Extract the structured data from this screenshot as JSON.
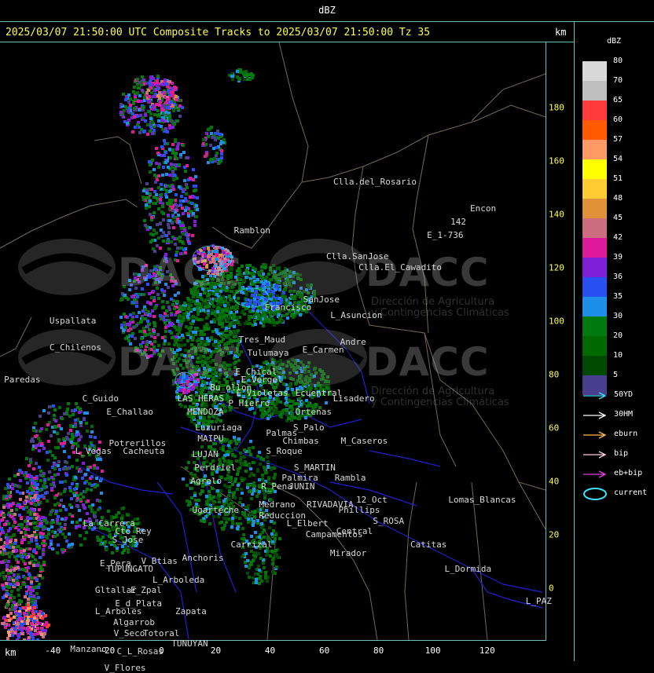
{
  "header": {
    "title": "dBZ"
  },
  "map": {
    "track_title": "2025/03/07 21:50:00 UTC Composite Tracks to 2025/03/07 21:50:00 Tz 35",
    "km_label": "km",
    "x_ticks": [
      -40,
      -20,
      0,
      20,
      40,
      60,
      80,
      100,
      120
    ],
    "y_ticks": [
      180,
      160,
      140,
      120,
      100,
      80,
      60,
      40,
      20,
      0
    ],
    "xlim": [
      -59.5,
      141.5
    ],
    "ylim": [
      -19.5,
      204.5
    ],
    "watermark": {
      "brand": "DACC",
      "line1": "Dirección de Agricultura",
      "line2": "y Contingencias Climáticas"
    },
    "places": [
      {
        "name": "Clla.del_Rosario",
        "x": 63.3,
        "y": 152
      },
      {
        "name": "Encon",
        "x": 113.7,
        "y": 142
      },
      {
        "name": "142",
        "x": 106.5,
        "y": 137
      },
      {
        "name": "E_1-736",
        "x": 97.8,
        "y": 132
      },
      {
        "name": "Ramblon",
        "x": 26.7,
        "y": 134
      },
      {
        "name": "Clla.SanJose",
        "x": 60.7,
        "y": 124
      },
      {
        "name": "Clla.El_Cawadito",
        "x": 72.6,
        "y": 120
      },
      {
        "name": "SanJose",
        "x": 52.2,
        "y": 108
      },
      {
        "name": "Francisco",
        "x": 38,
        "y": 105
      },
      {
        "name": "L_Asuncion",
        "x": 62.2,
        "y": 102
      },
      {
        "name": "Uspallata",
        "x": -41.3,
        "y": 100
      },
      {
        "name": "C_Chilenos",
        "x": -41.3,
        "y": 90
      },
      {
        "name": "Tres_Maud",
        "x": 28.4,
        "y": 93
      },
      {
        "name": "E_Carmen",
        "x": 51.9,
        "y": 89
      },
      {
        "name": "Andre",
        "x": 65.8,
        "y": 92
      },
      {
        "name": "Tulumaya",
        "x": 31.6,
        "y": 88
      },
      {
        "name": "Paredas",
        "x": -58,
        "y": 78
      },
      {
        "name": "E_Chical",
        "x": 27.2,
        "y": 81
      },
      {
        "name": "E_Vergel",
        "x": 29.3,
        "y": 78
      },
      {
        "name": "Ecuentral",
        "x": 49.3,
        "y": 73
      },
      {
        "name": "Bu_ollon",
        "x": 17.9,
        "y": 75
      },
      {
        "name": "E_Violetas",
        "x": 27.5,
        "y": 73
      },
      {
        "name": "Lisadero",
        "x": 63.2,
        "y": 71
      },
      {
        "name": "C_Guido",
        "x": -29.2,
        "y": 71
      },
      {
        "name": "LAS_HERAS",
        "x": 5.8,
        "y": 71
      },
      {
        "name": "P_Hierro",
        "x": 24.6,
        "y": 69
      },
      {
        "name": "E_Challao",
        "x": -20.3,
        "y": 66
      },
      {
        "name": "MENDOZA",
        "x": 9.5,
        "y": 66
      },
      {
        "name": "Ortenas",
        "x": 49.3,
        "y": 66
      },
      {
        "name": "Luzuriaga",
        "x": 12.4,
        "y": 60
      },
      {
        "name": "S_Palo",
        "x": 48.5,
        "y": 60
      },
      {
        "name": "Palmas",
        "x": 38.5,
        "y": 58
      },
      {
        "name": "Potrerillos",
        "x": -19.4,
        "y": 54
      },
      {
        "name": "MAIPU",
        "x": 13.3,
        "y": 56
      },
      {
        "name": "Chimbas",
        "x": 44.6,
        "y": 55
      },
      {
        "name": "M_Caseros",
        "x": 66.1,
        "y": 55
      },
      {
        "name": "L_Vegas",
        "x": -31.8,
        "y": 51
      },
      {
        "name": "Cacheuta",
        "x": -14.2,
        "y": 51
      },
      {
        "name": "LUJAN",
        "x": 11.3,
        "y": 50
      },
      {
        "name": "S_Roque",
        "x": 38.5,
        "y": 51
      },
      {
        "name": "Perdriel",
        "x": 12.1,
        "y": 45
      },
      {
        "name": "S_MARTIN",
        "x": 48.8,
        "y": 45
      },
      {
        "name": "Agrelo",
        "x": 10.7,
        "y": 40
      },
      {
        "name": "Palmira",
        "x": 44.3,
        "y": 41
      },
      {
        "name": "Rambla",
        "x": 63.8,
        "y": 41
      },
      {
        "name": "R_Pena",
        "x": 36.7,
        "y": 38
      },
      {
        "name": "JUNIN",
        "x": 46.9,
        "y": 38
      },
      {
        "name": "Lomas_Blancas",
        "x": 105.7,
        "y": 33
      },
      {
        "name": "RIVADAVIA",
        "x": 53.5,
        "y": 31
      },
      {
        "name": "12_Oct",
        "x": 71.7,
        "y": 33
      },
      {
        "name": "Ugarteche",
        "x": 11.3,
        "y": 29
      },
      {
        "name": "Medrano",
        "x": 35.9,
        "y": 31
      },
      {
        "name": "Reduccion",
        "x": 35.9,
        "y": 27
      },
      {
        "name": "Phillips",
        "x": 65.2,
        "y": 29
      },
      {
        "name": "S_ROSA",
        "x": 77.9,
        "y": 25
      },
      {
        "name": "La_Carrera",
        "x": -28.9,
        "y": 24
      },
      {
        "name": "Cto_Rey",
        "x": -17.1,
        "y": 21
      },
      {
        "name": "L_Elbert",
        "x": 46.1,
        "y": 24
      },
      {
        "name": "Central",
        "x": 64.4,
        "y": 21
      },
      {
        "name": "Campamentos",
        "x": 53.1,
        "y": 20
      },
      {
        "name": "S_Jose",
        "x": -18.2,
        "y": 18
      },
      {
        "name": "Carrizal",
        "x": 25.5,
        "y": 16
      },
      {
        "name": "Catitas",
        "x": 91.7,
        "y": 16
      },
      {
        "name": "Anchoris",
        "x": 7.6,
        "y": 11
      },
      {
        "name": "Mirador",
        "x": 62.1,
        "y": 13
      },
      {
        "name": "E_Pera",
        "x": -22.7,
        "y": 9
      },
      {
        "name": "V_Btias",
        "x": -7.5,
        "y": 10
      },
      {
        "name": "TUPUNGATO",
        "x": -20.3,
        "y": 7
      },
      {
        "name": "L_Dormida",
        "x": 104.3,
        "y": 7
      },
      {
        "name": "L_Arboleda",
        "x": -3.3,
        "y": 3
      },
      {
        "name": "Gltallar",
        "x": -24.5,
        "y": -1
      },
      {
        "name": "E_Zpal",
        "x": -11.4,
        "y": -1
      },
      {
        "name": "E_d_Plata",
        "x": -17.1,
        "y": -6
      },
      {
        "name": "L_PAZ",
        "x": 134.2,
        "y": -5
      },
      {
        "name": "L_Arboles",
        "x": -24.5,
        "y": -9
      },
      {
        "name": "Zapata",
        "x": 5.1,
        "y": -9
      },
      {
        "name": "Algarrob",
        "x": -17.8,
        "y": -13
      },
      {
        "name": "V_Seco",
        "x": -17.6,
        "y": -17
      },
      {
        "name": "Totoral",
        "x": -6.8,
        "y": -17
      },
      {
        "name": "TUNUYAN",
        "x": 3.7,
        "y": -21
      },
      {
        "name": "Manzano",
        "x": -33.6,
        "y": -23
      },
      {
        "name": "C_L_Rosas",
        "x": -16.5,
        "y": -24
      },
      {
        "name": "V_Flores",
        "x": -21.1,
        "y": -30
      }
    ]
  },
  "legend": {
    "title": "dBZ",
    "scale": [
      {
        "value": "80",
        "color": "#d8d8d8"
      },
      {
        "value": "70",
        "color": "#bfbfbf"
      },
      {
        "value": "65",
        "color": "#ff3c3c"
      },
      {
        "value": "60",
        "color": "#ff5a00"
      },
      {
        "value": "57",
        "color": "#ff9966"
      },
      {
        "value": "54",
        "color": "#ffff00"
      },
      {
        "value": "51",
        "color": "#ffcc33"
      },
      {
        "value": "48",
        "color": "#e0913a"
      },
      {
        "value": "45",
        "color": "#cc6d80"
      },
      {
        "value": "42",
        "color": "#dd1a99"
      },
      {
        "value": "39",
        "color": "#7f1fd8"
      },
      {
        "value": "36",
        "color": "#2850f0"
      },
      {
        "value": "35",
        "color": "#1e8fe8"
      },
      {
        "value": "30",
        "color": "#007a0f"
      },
      {
        "value": "20",
        "color": "#006a00"
      },
      {
        "value": "10",
        "color": "#004a00"
      },
      {
        "value": "5",
        "color": "#4a3f8f"
      }
    ],
    "tracks": [
      {
        "label": "50YD",
        "color": "#40e0ff"
      },
      {
        "label": "30HM",
        "color": "#ffffff"
      },
      {
        "label": "eburn",
        "color": "#ffb84d"
      },
      {
        "label": "bip",
        "color": "#ffd0e0"
      },
      {
        "label": "eb+bip",
        "color": "#e040e0"
      }
    ],
    "current_label": "current",
    "current_color": "#40e0ff"
  }
}
